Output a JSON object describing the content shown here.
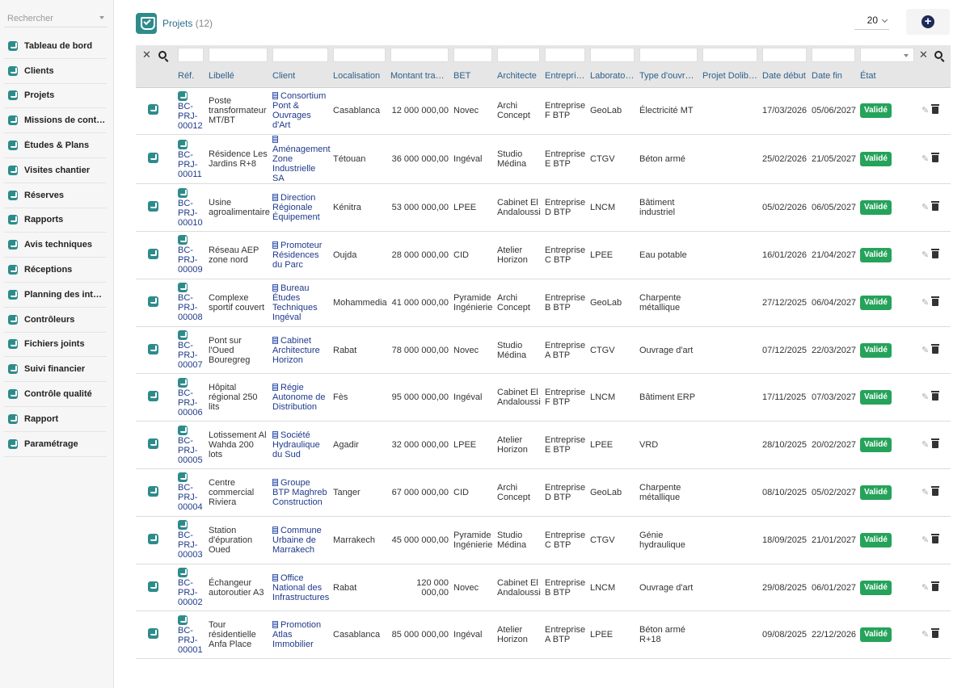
{
  "sidebar": {
    "search_placeholder": "Rechercher",
    "items": [
      {
        "label": "Tableau de bord"
      },
      {
        "label": "Clients"
      },
      {
        "label": "Projets"
      },
      {
        "label": "Missions de contrôle"
      },
      {
        "label": "Études & Plans"
      },
      {
        "label": "Visites chantier"
      },
      {
        "label": "Réserves"
      },
      {
        "label": "Rapports"
      },
      {
        "label": "Avis techniques"
      },
      {
        "label": "Réceptions"
      },
      {
        "label": "Planning des interv…"
      },
      {
        "label": "Contrôleurs"
      },
      {
        "label": "Fichiers joints"
      },
      {
        "label": "Suivi financier"
      },
      {
        "label": "Contrôle qualité"
      },
      {
        "label": "Rapport"
      },
      {
        "label": "Paramétrage"
      }
    ]
  },
  "header": {
    "title": "Projets",
    "count": "(12)",
    "per_page": "20",
    "add_icon": "plus-circle-icon"
  },
  "table": {
    "columns": [
      "Réf.",
      "Libellé",
      "Client",
      "Localisation",
      "Montant trav…",
      "BET",
      "Architecte",
      "Entreprise",
      "Laboratoire",
      "Type d'ouvra…",
      "Projet Dolibarr",
      "Date début",
      "Date fin",
      "État"
    ],
    "rows": [
      {
        "ref": "BC-PRJ-00012",
        "libelle": "Poste transformateur MT/BT",
        "client": "Consortium Pont & Ouvrages d'Art",
        "localisation": "Casablanca",
        "montant": "12 000 000,00",
        "bet": "Novec",
        "architecte": "Archi Concept",
        "entreprise": "Entreprise F BTP",
        "laboratoire": "GeoLab",
        "type": "Électricité MT",
        "dolibarr": "",
        "date_debut": "17/03/2026",
        "date_fin": "05/06/2027",
        "etat": "Validé"
      },
      {
        "ref": "BC-PRJ-00011",
        "libelle": "Résidence Les Jardins R+8",
        "client": "Aménagement Zone Industrielle SA",
        "localisation": "Tétouan",
        "montant": "36 000 000,00",
        "bet": "Ingéval",
        "architecte": "Studio Médina",
        "entreprise": "Entreprise E BTP",
        "laboratoire": "CTGV",
        "type": "Béton armé",
        "dolibarr": "",
        "date_debut": "25/02/2026",
        "date_fin": "21/05/2027",
        "etat": "Validé"
      },
      {
        "ref": "BC-PRJ-00010",
        "libelle": "Usine agroalimentaire",
        "client": "Direction Régionale Équipement",
        "localisation": "Kénitra",
        "montant": "53 000 000,00",
        "bet": "LPEE",
        "architecte": "Cabinet El Andaloussi",
        "entreprise": "Entreprise D BTP",
        "laboratoire": "LNCM",
        "type": "Bâtiment industriel",
        "dolibarr": "",
        "date_debut": "05/02/2026",
        "date_fin": "06/05/2027",
        "etat": "Validé"
      },
      {
        "ref": "BC-PRJ-00009",
        "libelle": "Réseau AEP zone nord",
        "client": "Promoteur Résidences du Parc",
        "localisation": "Oujda",
        "montant": "28 000 000,00",
        "bet": "CID",
        "architecte": "Atelier Horizon",
        "entreprise": "Entreprise C BTP",
        "laboratoire": "LPEE",
        "type": "Eau potable",
        "dolibarr": "",
        "date_debut": "16/01/2026",
        "date_fin": "21/04/2027",
        "etat": "Validé"
      },
      {
        "ref": "BC-PRJ-00008",
        "libelle": "Complexe sportif couvert",
        "client": "Bureau Études Techniques Ingéval",
        "localisation": "Mohammedia",
        "montant": "41 000 000,00",
        "bet": "Pyramide Ingénierie",
        "architecte": "Archi Concept",
        "entreprise": "Entreprise B BTP",
        "laboratoire": "GeoLab",
        "type": "Charpente métallique",
        "dolibarr": "",
        "date_debut": "27/12/2025",
        "date_fin": "06/04/2027",
        "etat": "Validé"
      },
      {
        "ref": "BC-PRJ-00007",
        "libelle": "Pont sur l'Oued Bouregreg",
        "client": "Cabinet Architecture Horizon",
        "localisation": "Rabat",
        "montant": "78 000 000,00",
        "bet": "Novec",
        "architecte": "Studio Médina",
        "entreprise": "Entreprise A BTP",
        "laboratoire": "CTGV",
        "type": "Ouvrage d'art",
        "dolibarr": "",
        "date_debut": "07/12/2025",
        "date_fin": "22/03/2027",
        "etat": "Validé"
      },
      {
        "ref": "BC-PRJ-00006",
        "libelle": "Hôpital régional 250 lits",
        "client": "Régie Autonome de Distribution",
        "localisation": "Fès",
        "montant": "95 000 000,00",
        "bet": "Ingéval",
        "architecte": "Cabinet El Andaloussi",
        "entreprise": "Entreprise F BTP",
        "laboratoire": "LNCM",
        "type": "Bâtiment ERP",
        "dolibarr": "",
        "date_debut": "17/11/2025",
        "date_fin": "07/03/2027",
        "etat": "Validé"
      },
      {
        "ref": "BC-PRJ-00005",
        "libelle": "Lotissement Al Wahda 200 lots",
        "client": "Société Hydraulique du Sud",
        "localisation": "Agadir",
        "montant": "32 000 000,00",
        "bet": "LPEE",
        "architecte": "Atelier Horizon",
        "entreprise": "Entreprise E BTP",
        "laboratoire": "LPEE",
        "type": "VRD",
        "dolibarr": "",
        "date_debut": "28/10/2025",
        "date_fin": "20/02/2027",
        "etat": "Validé"
      },
      {
        "ref": "BC-PRJ-00004",
        "libelle": "Centre commercial Riviera",
        "client": "Groupe BTP Maghreb Construction",
        "localisation": "Tanger",
        "montant": "67 000 000,00",
        "bet": "CID",
        "architecte": "Archi Concept",
        "entreprise": "Entreprise D BTP",
        "laboratoire": "GeoLab",
        "type": "Charpente métallique",
        "dolibarr": "",
        "date_debut": "08/10/2025",
        "date_fin": "05/02/2027",
        "etat": "Validé"
      },
      {
        "ref": "BC-PRJ-00003",
        "libelle": "Station d'épuration Oued",
        "client": "Commune Urbaine de Marrakech",
        "localisation": "Marrakech",
        "montant": "45 000 000,00",
        "bet": "Pyramide Ingénierie",
        "architecte": "Studio Médina",
        "entreprise": "Entreprise C BTP",
        "laboratoire": "CTGV",
        "type": "Génie hydraulique",
        "dolibarr": "",
        "date_debut": "18/09/2025",
        "date_fin": "21/01/2027",
        "etat": "Validé"
      },
      {
        "ref": "BC-PRJ-00002",
        "libelle": "Échangeur autoroutier A3",
        "client": "Office National des Infrastructures",
        "localisation": "Rabat",
        "montant": "120 000 000,00",
        "bet": "Novec",
        "architecte": "Cabinet El Andaloussi",
        "entreprise": "Entreprise B BTP",
        "laboratoire": "LNCM",
        "type": "Ouvrage d'art",
        "dolibarr": "",
        "date_debut": "29/08/2025",
        "date_fin": "06/01/2027",
        "etat": "Validé"
      },
      {
        "ref": "BC-PRJ-00001",
        "libelle": "Tour résidentielle Anfa Place",
        "client": "Promotion Atlas Immobilier",
        "localisation": "Casablanca",
        "montant": "85 000 000,00",
        "bet": "Ingéval",
        "architecte": "Atelier Horizon",
        "entreprise": "Entreprise A BTP",
        "laboratoire": "LPEE",
        "type": "Béton armé R+18",
        "dolibarr": "",
        "date_debut": "09/08/2025",
        "date_fin": "22/12/2026",
        "etat": "Validé"
      }
    ]
  },
  "colors": {
    "accent": "#2e8b8b",
    "link": "#1f3a8a",
    "badge": "#25a35a",
    "header_bg": "#e6e6e6"
  }
}
